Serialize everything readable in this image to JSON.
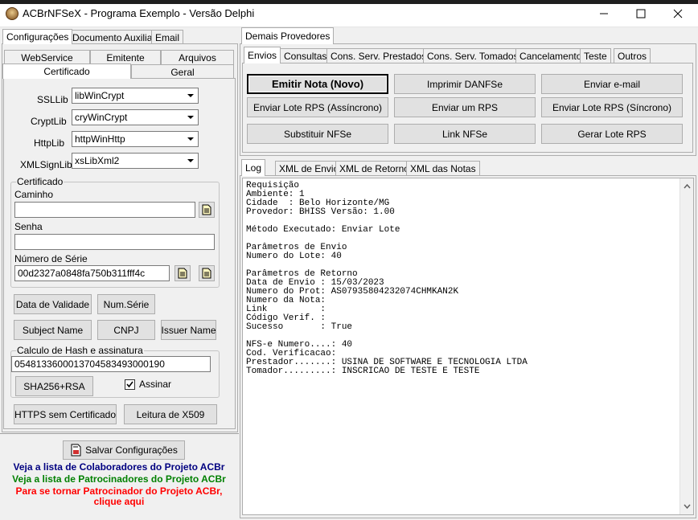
{
  "window": {
    "title": "ACBrNFSeX - Programa Exemplo - Versão Delphi"
  },
  "left_tabs": {
    "main": [
      "Configurações",
      "Documento Auxiliar",
      "Email"
    ],
    "sub_row1": [
      "WebService",
      "Emitente",
      "Arquivos"
    ],
    "sub_row2": [
      "Certificado",
      "Geral"
    ]
  },
  "cert_config": {
    "ssllib_label": "SSLLib",
    "ssllib_value": "libWinCrypt",
    "cryptlib_label": "CryptLib",
    "cryptlib_value": "cryWinCrypt",
    "httplib_label": "HttpLib",
    "httplib_value": "httpWinHttp",
    "xmlsignlib_label": "XMLSignLib",
    "xmlsignlib_value": "xsLibXml2"
  },
  "certificado": {
    "group_title": "Certificado",
    "caminho_label": "Caminho",
    "caminho_value": "",
    "senha_label": "Senha",
    "senha_value": "",
    "serie_label": "Número de Série",
    "serie_value": "00d2327a0848fa750b311fff4c"
  },
  "cert_buttons": {
    "data_validade": "Data de Validade",
    "num_serie": "Num.Série",
    "subject_name": "Subject Name",
    "cnpj": "CNPJ",
    "issuer_name": "Issuer Name"
  },
  "hash": {
    "group_title": "Calculo de Hash e assinatura",
    "value": "05481336000137045834930001​90",
    "sha_button": "SHA256+RSA",
    "assinar_label": "Assinar",
    "assinar_checked": true
  },
  "bottom_buttons": {
    "https": "HTTPS sem Certificado",
    "x509": "Leitura de X509"
  },
  "save_button": "Salvar Configurações",
  "links": {
    "colaboradores": "Veja a lista de Colaboradores do Projeto ACBr",
    "patrocinadores": "Veja a lista de Patrocinadores do Projeto ACBr",
    "patrocinador_l1": "Para se tornar Patrocinador do Projeto ACBr,",
    "patrocinador_l2": "clique aqui",
    "colors": {
      "colaboradores": "#000080",
      "patrocinadores": "#008000",
      "patrocinador": "#ff0000"
    }
  },
  "right_tabs": {
    "top": [
      "Demais Provedores"
    ],
    "sub": [
      "Envios",
      "Consultas",
      "Cons. Serv. Prestados",
      "Cons. Serv. Tomados",
      "Cancelamento",
      "Teste",
      "Outros"
    ]
  },
  "actions": {
    "emitir_nota": "Emitir Nota (Novo)",
    "imprimir_danfse": "Imprimir DANFSe",
    "enviar_email": "Enviar e-mail",
    "enviar_lote_assinc": "Enviar Lote RPS (Assíncrono)",
    "enviar_um_rps": "Enviar um RPS",
    "enviar_lote_sinc": "Enviar Lote RPS (Síncrono)",
    "substituir": "Substituir NFSe",
    "link_nfse": "Link NFSe",
    "gerar_lote": "Gerar Lote RPS"
  },
  "log_tabs": [
    "Log",
    "XML de Envio",
    "XML de Retorno",
    "XML das Notas"
  ],
  "log_text": "Requisição\nAmbiente: 1\nCidade  : Belo Horizonte/MG\nProvedor: BHISS Versão: 1.00\n\nMétodo Executado: Enviar Lote\n\nParâmetros de Envio\nNumero do Lote: 40\n\nParâmetros de Retorno\nData de Envio : 15/03/2023\nNumero do Prot: AS07935804232074CHMKAN2K\nNumero da Nota:\nLink          :\nCódigo Verif. :\nSucesso       : True\n\nNFS-e Numero....: 40\nCod. Verificacao:\nPrestador.......: USINA DE SOFTWARE E TECNOLOGIA LTDA\nTomador.........: INSCRICAO DE TESTE E TESTE"
}
